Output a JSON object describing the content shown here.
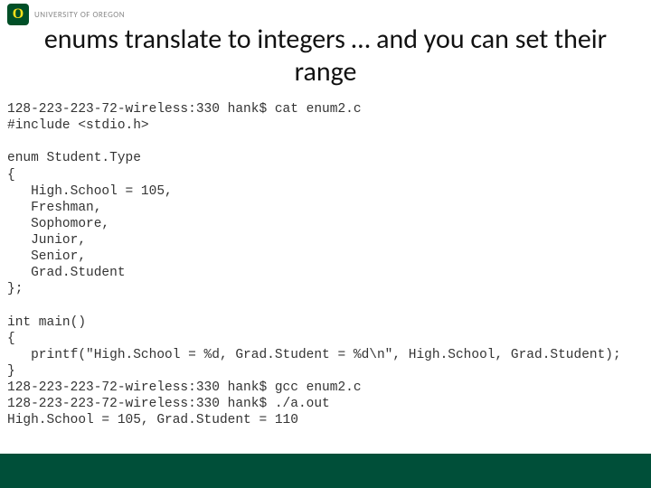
{
  "logo": {
    "letter": "O",
    "text": "UNIVERSITY OF OREGON"
  },
  "title": "enums translate to integers … and you can set their range",
  "terminal_lines": [
    "128-223-223-72-wireless:330 hank$ cat enum2.c",
    "#include <stdio.h>",
    "",
    "enum Student.Type",
    "{",
    "   High.School = 105,",
    "   Freshman,",
    "   Sophomore,",
    "   Junior,",
    "   Senior,",
    "   Grad.Student",
    "};",
    "",
    "int main()",
    "{",
    "   printf(\"High.School = %d, Grad.Student = %d\\n\", High.School, Grad.Student);",
    "}",
    "128-223-223-72-wireless:330 hank$ gcc enum2.c",
    "128-223-223-72-wireless:330 hank$ ./a.out",
    "High.School = 105, Grad.Student = 110"
  ]
}
